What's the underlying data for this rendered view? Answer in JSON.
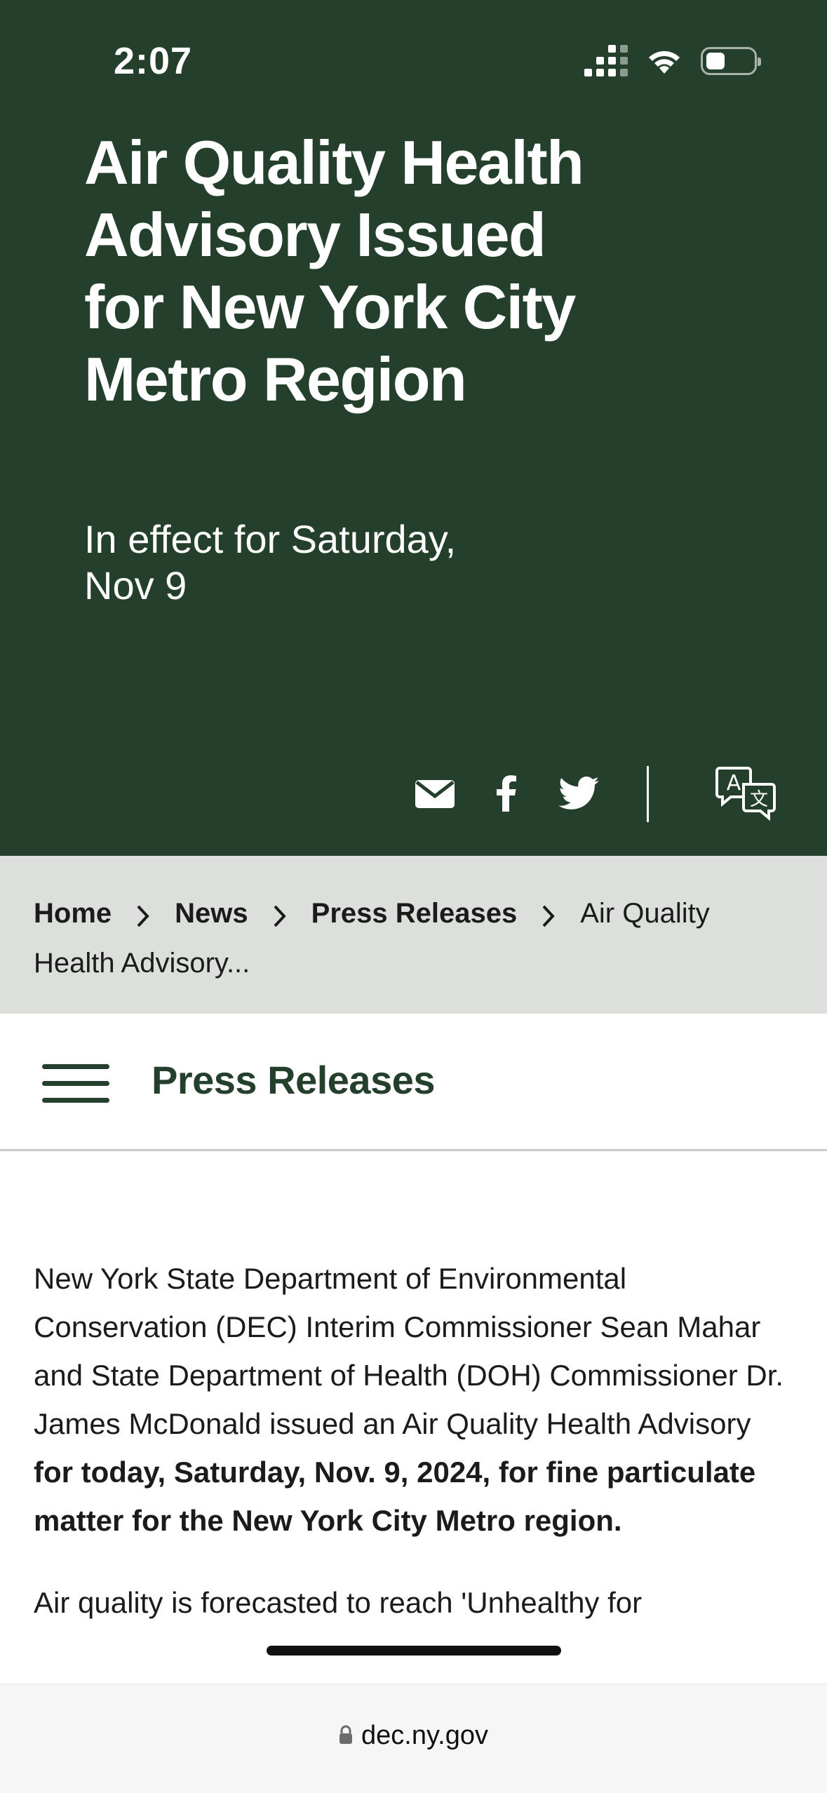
{
  "status_bar": {
    "time": "2:07"
  },
  "hero": {
    "title": "Air Quality Health Advisory Issued for New York City Metro Region",
    "subtitle": "In effect for Saturday, Nov 9",
    "share_icons": [
      "email-icon",
      "facebook-icon",
      "twitter-icon",
      "translate-icon"
    ]
  },
  "breadcrumb": {
    "items": [
      "Home",
      "News",
      "Press Releases"
    ],
    "current": "Air Quality Health Advisory..."
  },
  "section_nav": {
    "title": "Press Releases"
  },
  "article": {
    "p1_start": "New York State Department of Environmental Conservation (DEC) Interim Commissioner Sean Mahar and State Department of Health (DOH) Commissioner Dr. James McDonald issued an Air Quality Health Advisory ",
    "p1_bold": "for today, Saturday, Nov. 9, 2024, for fine particulate matter for the New York City Metro region.",
    "p2": "Air quality is forecasted to reach 'Unhealthy for"
  },
  "browser": {
    "url": "dec.ny.gov"
  },
  "colors": {
    "brand_green": "#243f2c",
    "breadcrumb_bg": "#dcdfdc"
  }
}
